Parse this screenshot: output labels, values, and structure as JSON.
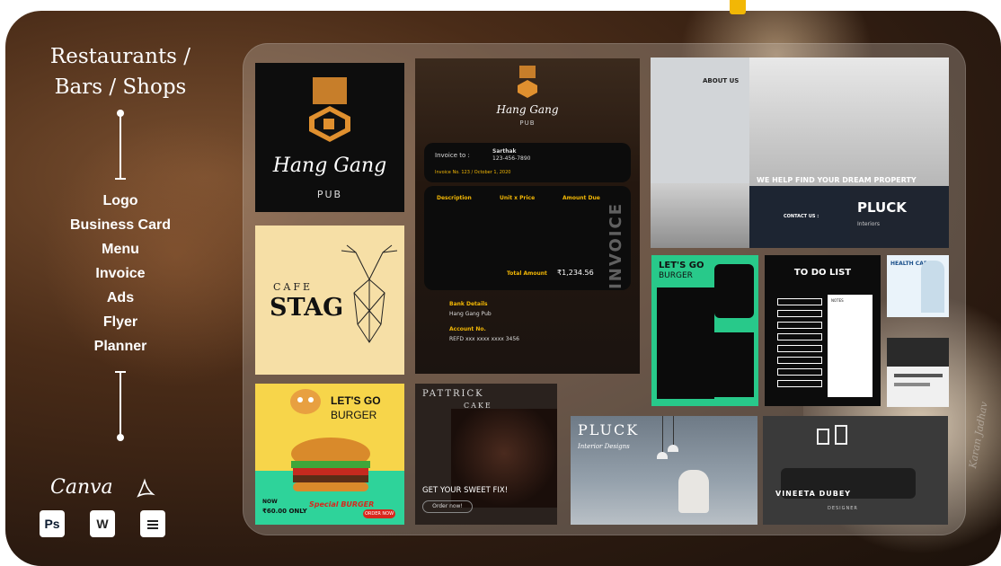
{
  "panel": {
    "title_line1": "Restaurants /",
    "title_line2": "Bars / Shops",
    "items": [
      "Logo",
      "Business Card",
      "Menu",
      "Invoice",
      "Ads",
      "Flyer",
      "Planner"
    ]
  },
  "tools": {
    "canva": "Canva",
    "apps": [
      {
        "name": "photoshop-icon",
        "label": "Ps"
      },
      {
        "name": "word-icon",
        "label": "W"
      },
      {
        "name": "google-docs-icon",
        "label": ""
      }
    ]
  },
  "samples": {
    "logo": {
      "script": "Hang Gang",
      "sub": "PUB"
    },
    "cafe": {
      "small": "CAFE",
      "name": "STAG"
    },
    "burger_ad": {
      "line1": "LET'S GO",
      "line2": "BURGER",
      "now": "NOW",
      "price": "₹60.00 ONLY",
      "special": "Special BURGER",
      "order": "ORDER NOW"
    },
    "invoice": {
      "script": "Hang Gang",
      "sub": "PUB",
      "invoice_to": "Invoice to :",
      "client": "Sarthak",
      "phone": "123-456-7890",
      "invoice_no": "Invoice No. 123 / October 1, 2020",
      "col_desc": "Description",
      "col_unit": "Unit x Price",
      "col_due": "Amount Due",
      "total_label": "Total Amount",
      "total_value": "₹1,234.56",
      "vertical": "INVOICE",
      "bank_label": "Bank Details",
      "bank_value": "Hang Gang Pub",
      "account_label": "Account No.",
      "account_value": "REFD xxx xxxx xxxx 3456"
    },
    "interior": {
      "about": "ABOUT US",
      "help": "WE HELP FIND YOUR DREAM PROPERTY",
      "contact": "CONTACT US :",
      "brand": "PLUCK",
      "brand_sub": "Interiors"
    },
    "burger_menu": {
      "line1": "LET'S GO",
      "line2": "BURGER"
    },
    "todo": {
      "title": "TO DO LIST",
      "notes": "NOTES"
    },
    "health": {
      "title": "HEALTH CARE"
    },
    "cake": {
      "brand1": "PATTRICK",
      "brand2": "CAKE",
      "tagline": "GET YOUR SWEET FIX!",
      "order": "Order now!"
    },
    "pluck_ad": {
      "brand": "PLUCK",
      "sub": "Interior Designs"
    },
    "vineeta": {
      "name": "VINEETA DUBEY",
      "role": "DESIGNER"
    }
  },
  "signature": "Karan Jadhav",
  "colors": {
    "accent": "#f2b705",
    "burger_green": "#2ed39a",
    "burger_yellow": "#f7d54a"
  }
}
